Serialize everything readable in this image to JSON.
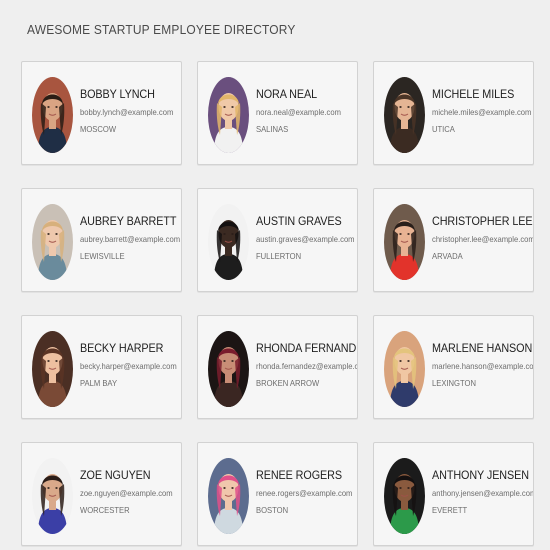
{
  "page": {
    "title": "AWESOME STARTUP EMPLOYEE DIRECTORY"
  },
  "employees": [
    {
      "name": "BOBBY LYNCH",
      "email": "bobby.lynch@example.com",
      "city": "MOSCOW",
      "avatar": {
        "bg": "#a8553f",
        "skin": "#d9a483",
        "hair": "#2a1d15",
        "shirt": "#1f2e45"
      }
    },
    {
      "name": "NORA NEAL",
      "email": "nora.neal@example.com",
      "city": "SALINAS",
      "avatar": {
        "bg": "#6a4f7e",
        "skin": "#f0c9a8",
        "hair": "#e3b66a",
        "shirt": "#f1f1f1"
      }
    },
    {
      "name": "MICHELE MILES",
      "email": "michele.miles@example.com",
      "city": "UTICA",
      "avatar": {
        "bg": "#2b2622",
        "skin": "#e5b594",
        "hair": "#4a3426",
        "shirt": "#3b2b22"
      }
    },
    {
      "name": "AUBREY BARRETT",
      "email": "aubrey.barrett@example.com",
      "city": "LEWISVILLE",
      "avatar": {
        "bg": "#c9c0b6",
        "skin": "#eec8ad",
        "hair": "#d7b07c",
        "shirt": "#6a8b9c"
      }
    },
    {
      "name": "AUSTIN GRAVES",
      "email": "austin.graves@example.com",
      "city": "FULLERTON",
      "avatar": {
        "bg": "#f2f2f2",
        "skin": "#3b2a22",
        "hair": "#141010",
        "shirt": "#1d1d1d"
      }
    },
    {
      "name": "CHRISTOPHER LEE",
      "email": "christopher.lee@example.com",
      "city": "ARVADA",
      "avatar": {
        "bg": "#6f5b4c",
        "skin": "#e8b393",
        "hair": "#2a1f1a",
        "shirt": "#e2332b"
      }
    },
    {
      "name": "BECKY HARPER",
      "email": "becky.harper@example.com",
      "city": "PALM BAY",
      "avatar": {
        "bg": "#4b2f24",
        "skin": "#edc0a0",
        "hair": "#5b3424",
        "shirt": "#7a4a36"
      }
    },
    {
      "name": "RHONDA FERNANDEZ",
      "email": "rhonda.fernandez@example.com",
      "city": "BROKEN ARROW",
      "avatar": {
        "bg": "#1c1514",
        "skin": "#c88d76",
        "hair": "#7a1d2d",
        "shirt": "#3a2622"
      }
    },
    {
      "name": "MARLENE HANSON",
      "email": "marlene.hanson@example.com",
      "city": "LEXINGTON",
      "avatar": {
        "bg": "#d9a37c",
        "skin": "#f0c7a3",
        "hair": "#e4c47d",
        "shirt": "#2f3b6b"
      }
    },
    {
      "name": "ZOE NGUYEN",
      "email": "zoe.nguyen@example.com",
      "city": "WORCESTER",
      "avatar": {
        "bg": "#f2f2f2",
        "skin": "#d9a98a",
        "hair": "#2b1d18",
        "shirt": "#3b3fa6"
      }
    },
    {
      "name": "RENEE ROGERS",
      "email": "renee.rogers@example.com",
      "city": "BOSTON",
      "avatar": {
        "bg": "#5c6c8f",
        "skin": "#f0c7ac",
        "hair": "#e0508a",
        "shirt": "#cfd9e0"
      }
    },
    {
      "name": "ANTHONY JENSEN",
      "email": "anthony.jensen@example.com",
      "city": "EVERETT",
      "avatar": {
        "bg": "#1b1b1b",
        "skin": "#8a5a3e",
        "hair": "#141010",
        "shirt": "#2c9a4a"
      }
    }
  ]
}
